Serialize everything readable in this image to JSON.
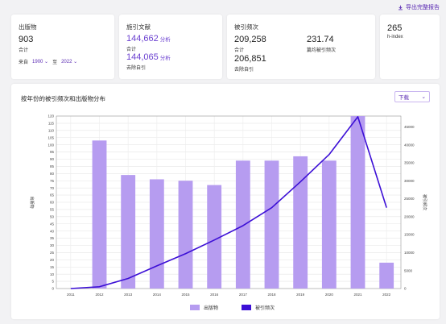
{
  "export": {
    "label": "导出完整报告",
    "icon": "download-icon"
  },
  "cards": {
    "publications": {
      "title": "出版物",
      "value": "903",
      "value_label": "合计",
      "from_label": "来自",
      "from_value": "1900",
      "to_label": "至",
      "to_value": "2022"
    },
    "citing": {
      "title": "施引文献",
      "total": "144,662",
      "total_unit": "分析",
      "total_label": "合计",
      "excl": "144,065",
      "excl_unit": "分析",
      "excl_label": "去除自引"
    },
    "times_cited": {
      "title": "被引频次",
      "total": "209,258",
      "total_label": "合计",
      "avg": "231.74",
      "avg_label": "篇均被引频次",
      "excl": "206,851",
      "excl_label": "去除自引"
    },
    "hindex": {
      "value": "265",
      "label": "h-index"
    }
  },
  "chart": {
    "title": "按年份的被引频次和出版物分布",
    "download_label": "下载",
    "legend_pub": "出版物",
    "legend_cite": "被引频次"
  },
  "colors": {
    "bar": "#b69cf0",
    "line": "#3c0fd6",
    "accent": "#5b2bb3"
  },
  "chart_data": {
    "type": "bar",
    "categories": [
      "2011",
      "2012",
      "2013",
      "2014",
      "2015",
      "2016",
      "2017",
      "2018",
      "2019",
      "2020",
      "2021",
      "2022"
    ],
    "series": [
      {
        "name": "出版物",
        "type": "bar",
        "axis": "left",
        "values": [
          0,
          103,
          79,
          76,
          75,
          72,
          89,
          89,
          92,
          89,
          120,
          18
        ]
      },
      {
        "name": "被引频次",
        "type": "line",
        "axis": "right",
        "values": [
          0,
          500,
          2800,
          6300,
          9700,
          13500,
          17500,
          22500,
          29700,
          37300,
          47800,
          22500
        ]
      }
    ],
    "ylabel": "出版物",
    "y2label": "被引频次",
    "ylim": [
      0,
      120
    ],
    "y2lim": [
      0,
      48000
    ],
    "yticks": [
      0,
      5,
      10,
      15,
      20,
      25,
      30,
      35,
      40,
      45,
      50,
      55,
      60,
      65,
      70,
      75,
      80,
      85,
      90,
      95,
      100,
      105,
      110,
      115,
      120
    ],
    "y2ticks": [
      0,
      5000,
      10000,
      15000,
      20000,
      25000,
      30000,
      35000,
      40000,
      45000
    ],
    "grid": true,
    "legend": "bottom-center"
  }
}
